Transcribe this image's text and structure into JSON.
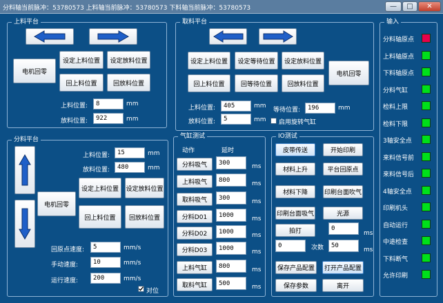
{
  "window": {
    "title": "分料轴当前脉冲：53780573 上料轴当前脉冲：53780573 下料轴当前脉冲：53780573",
    "btn_min": "—",
    "btn_max": "□",
    "btn_close": "✕"
  },
  "upper_platform": {
    "title": "上料平台",
    "home_btn": "电机回零",
    "set_load": "设定上料位置",
    "set_unload": "设定放料位置",
    "go_load": "回上料位置",
    "go_unload": "回放料位置",
    "load_pos_label": "上料位置:",
    "load_pos_value": "8",
    "unload_pos_label": "放料位置:",
    "unload_pos_value": "922",
    "unit": "mm"
  },
  "take_platform": {
    "title": "取料平台",
    "home_btn": "电机回零",
    "set_load": "设定上料位置",
    "set_wait": "设定等待位置",
    "set_unload": "设定放料位置",
    "go_load": "回上料位置",
    "go_wait": "回等待位置",
    "go_unload": "回放料位置",
    "load_pos_label": "上料位置:",
    "load_pos_value": "405",
    "unload_pos_label": "放料位置:",
    "unload_pos_value": "5",
    "wait_pos_label": "等待位置:",
    "wait_pos_value": "196",
    "rotate_label": "启用旋转气缸",
    "unit": "mm"
  },
  "split_platform": {
    "title": "分料平台",
    "home_btn": "电机回零",
    "set_load": "设定上料位置",
    "set_unload": "设定放料位置",
    "go_load": "回上料位置",
    "go_unload": "回放料位置",
    "load_pos_label": "上料位置:",
    "load_pos_value": "15",
    "unload_pos_label": "放料位置:",
    "unload_pos_value": "480",
    "unit": "mm",
    "home_speed_label": "回原点速度:",
    "home_speed_value": "5",
    "manual_speed_label": "手动速度:",
    "manual_speed_value": "10",
    "run_speed_label": "运行速度:",
    "run_speed_value": "200",
    "speed_unit": "mm/s",
    "align_label": "对位",
    "align_checked": true
  },
  "cylinder_test": {
    "title": "气缸测试",
    "col_action": "动作",
    "col_delay": "延时",
    "unit": "ms",
    "rows": [
      {
        "label": "分料吸气",
        "value": "300"
      },
      {
        "label": "上料吸气",
        "value": "800"
      },
      {
        "label": "取料吸气",
        "value": "300"
      },
      {
        "label": "分料D01",
        "value": "1000"
      },
      {
        "label": "分料D02",
        "value": "1000"
      },
      {
        "label": "分料D03",
        "value": "1000"
      },
      {
        "label": "上料气缸",
        "value": "800"
      },
      {
        "label": "取料气缸",
        "value": "500"
      }
    ]
  },
  "io_test": {
    "title": "IO测试",
    "belt": "皮带传送",
    "start_print": "开始印刷",
    "material_up": "材料上升",
    "platform_home": "平台回原点",
    "material_down": "材料下降",
    "print_blow": "印刷台面吹气",
    "print_suck": "印刷台面吸气",
    "light": "光源",
    "shoot": "拍打",
    "shoot_value": "0",
    "count_value": "0",
    "count_label": "次数",
    "count_ms_value": "50",
    "unit": "ms",
    "save_product": "保存产品配置",
    "open_product": "打开产品配置",
    "save_params": "保存参数",
    "exit": "离开"
  },
  "inputs": {
    "title": "输入",
    "items": [
      {
        "label": "分料轴原点",
        "color": "#e8004a"
      },
      {
        "label": "上料轴原点",
        "color": "#00e01a"
      },
      {
        "label": "下料轴原点",
        "color": "#00e01a"
      },
      {
        "label": "分料气缸",
        "color": "#00e01a"
      },
      {
        "label": "检料上限",
        "color": "#00e01a"
      },
      {
        "label": "检料下限",
        "color": "#00e01a"
      },
      {
        "label": "3轴安全点",
        "color": "#00e01a"
      },
      {
        "label": "来料信号前",
        "color": "#00e01a"
      },
      {
        "label": "来料信号后",
        "color": "#00e01a"
      },
      {
        "label": "4轴安全点",
        "color": "#00e01a"
      },
      {
        "label": "印刷机头",
        "color": "#00e01a"
      },
      {
        "label": "自动运行",
        "color": "#00e01a"
      },
      {
        "label": "中途检查",
        "color": "#00e01a"
      },
      {
        "label": "下料断气",
        "color": "#00e01a"
      },
      {
        "label": "允许印刷",
        "color": "#00e01a"
      }
    ]
  },
  "colors": {
    "background": "#0c4f86",
    "arrow": "#1f5fc8",
    "led_on": "#00e01a",
    "led_alarm": "#e8004a"
  }
}
